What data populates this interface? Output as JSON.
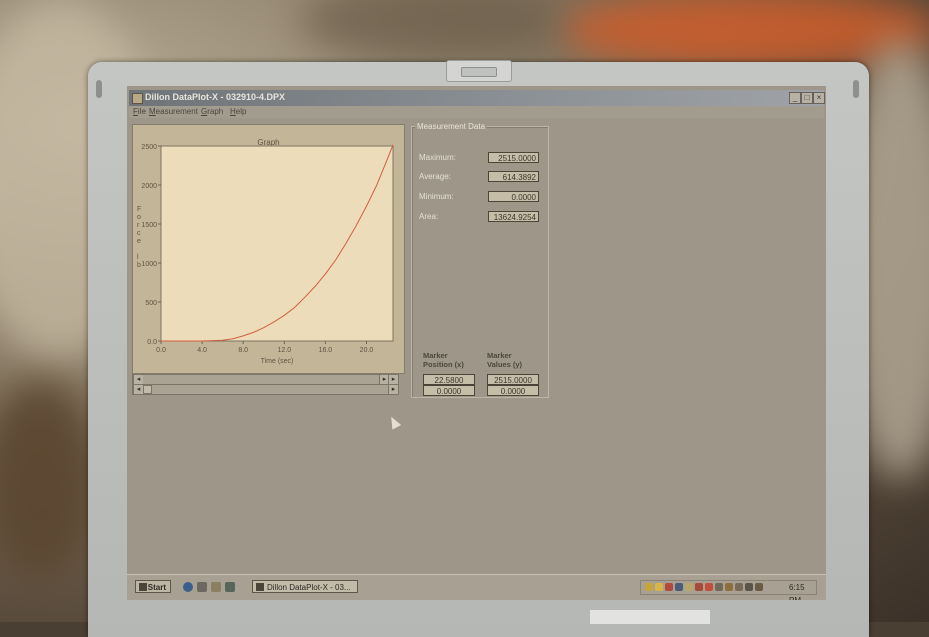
{
  "window": {
    "title": "Dillon DataPlot-X - 032910-4.DPX",
    "controls": [
      "_",
      "□",
      "×"
    ]
  },
  "menu": [
    {
      "key": "F",
      "rest": "ile"
    },
    {
      "key": "M",
      "rest": "easurement"
    },
    {
      "key": "G",
      "rest": "raph"
    },
    {
      "key": "H",
      "rest": "elp"
    }
  ],
  "graph": {
    "title": "Graph",
    "xlabel": "Time (sec)",
    "ylabel_letters": [
      "F",
      "o",
      "r",
      "c",
      "e",
      "",
      "l",
      "b"
    ]
  },
  "chart_data": {
    "type": "line",
    "title": "Graph",
    "xlabel": "Time (sec)",
    "ylabel": "Force lb",
    "xlim": [
      0,
      22.58
    ],
    "ylim": [
      0,
      2500
    ],
    "x_ticks": [
      "0.0",
      "4.0",
      "8.0",
      "12.0",
      "16.0",
      "20.0"
    ],
    "y_ticks": [
      "0.0",
      "500",
      "1000",
      "1500",
      "2000",
      "2500"
    ],
    "color": "#d2603f",
    "series": [
      {
        "x": [
          0,
          2,
          4,
          6,
          7,
          8,
          9,
          10,
          11,
          12,
          13,
          14,
          15,
          16,
          17,
          18,
          19,
          20,
          21,
          22,
          22.58
        ],
        "y": [
          0,
          0,
          0,
          10,
          30,
          65,
          110,
          170,
          245,
          330,
          430,
          560,
          700,
          860,
          1040,
          1250,
          1480,
          1730,
          2000,
          2320,
          2515
        ]
      }
    ]
  },
  "measurement": {
    "title": "Measurement Data",
    "rows": [
      {
        "label": "Maximum:",
        "value": "2515.0000"
      },
      {
        "label": "Average:",
        "value": "614.3892"
      },
      {
        "label": "Minimum:",
        "value": "0.0000"
      },
      {
        "label": "Area:",
        "value": "13624.9254"
      }
    ],
    "marker_x_header": [
      "Marker",
      "Position (x)"
    ],
    "marker_y_header": [
      "Marker",
      "Values (y)"
    ],
    "marker_x_values": [
      "22.5800",
      "0.0000"
    ],
    "marker_y_values": [
      "2515.0000",
      "0.0000"
    ]
  },
  "taskbar": {
    "start": "Start",
    "task": "Dillon DataPlot-X - 03...",
    "clock": "6:15 PM"
  }
}
